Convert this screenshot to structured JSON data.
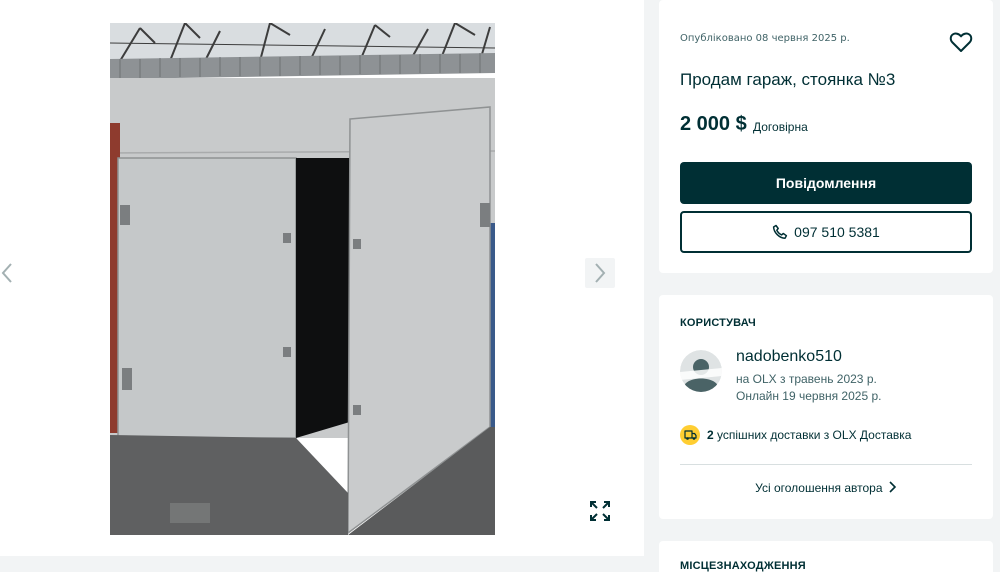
{
  "listing": {
    "posted": "Опубліковано 08 червня 2025 р.",
    "title": "Продам гараж, стоянка №3",
    "price": "2 000 $",
    "negotiable": "Договірна",
    "message_button": "Повідомлення",
    "phone": "097 510 5381"
  },
  "user": {
    "section_label": "КОРИСТУВАЧ",
    "username": "nadobenko510",
    "member_since": "на OLX з травень 2023 р.",
    "last_online": "Онлайн 19 червня 2025 р.",
    "delivery_count": "2",
    "delivery_text": "успішних доставки з OLX Доставка",
    "all_ads_link": "Усі оголошення автора"
  },
  "location": {
    "section_label": "МІСЦЕЗНАХОДЖЕННЯ"
  },
  "icons": {
    "prev": "chevron-left-icon",
    "next": "chevron-right-icon",
    "fullscreen": "expand-icon",
    "favorite": "heart-icon",
    "phone": "phone-icon",
    "delivery": "truck-icon",
    "link_arrow": "chevron-right-icon"
  },
  "colors": {
    "primary": "#002f34",
    "delivery_badge": "#ffce32",
    "background": "#f2f4f5"
  }
}
